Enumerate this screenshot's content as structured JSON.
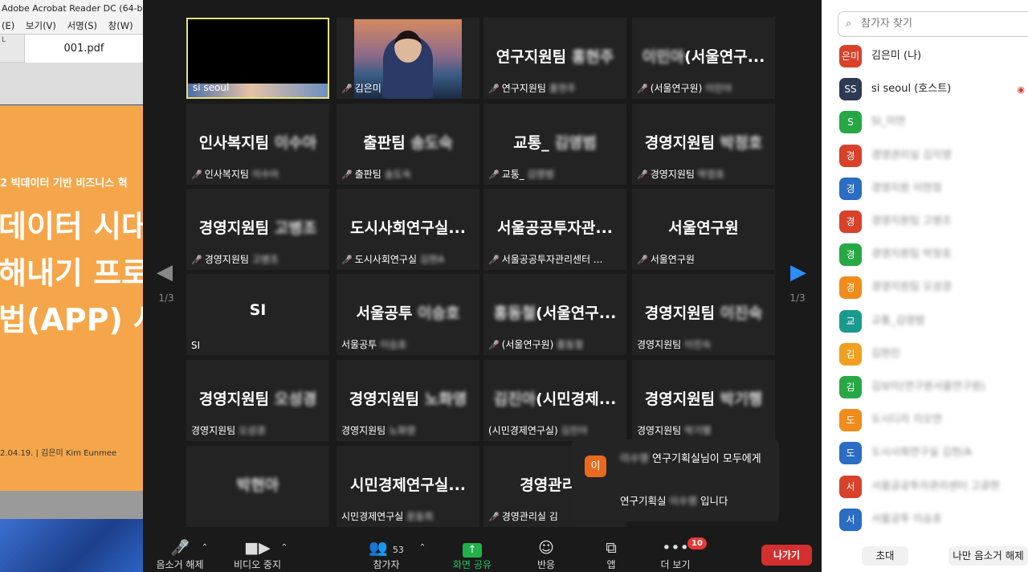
{
  "acrobat": {
    "title": "Adobe Acrobat Reader DC (64-b",
    "menus": [
      "(E)",
      "보기(V)",
      "서명(S)",
      "창(W)"
    ],
    "tab": "001.pdf",
    "tab_mark": "L",
    "slide_subtitle": "2 빅데이터 기반 비즈니스 혁",
    "slide_lines": [
      "데이터 시대",
      "해내기 프로",
      "법(APP) 사"
    ],
    "slide_footer": "2.04.19.   |   김은미 Kim Eunmee"
  },
  "tiles": [
    {
      "center": "",
      "label": "si seoul",
      "muted": false
    },
    {
      "center": "",
      "label": "김은미",
      "muted": true
    },
    {
      "center": "연구지원팀",
      "center_blur": "홍현주",
      "label": "연구지원팀",
      "label_blur": "홍현주",
      "muted": true
    },
    {
      "center": "(서울연구...",
      "center_blur": "이민아",
      "label": "(서울연구원)",
      "label_blur": "이민아",
      "muted": true
    },
    {
      "center": "인사복지팀",
      "center_blur": "이수아",
      "label": "인사복지팀",
      "label_blur": "이수아",
      "muted": true
    },
    {
      "center": "출판팀",
      "center_blur": "송도숙",
      "label": "출판팀",
      "label_blur": "송도숙",
      "muted": true
    },
    {
      "center": "교통_",
      "center_blur": "김영범",
      "label": "교통_",
      "label_blur": "김영범",
      "muted": true
    },
    {
      "center": "경영지원팀",
      "center_blur": "박정호",
      "label": "경영지원팀",
      "label_blur": "박정호",
      "muted": true
    },
    {
      "center": "경영지원팀",
      "center_blur": "고병조",
      "label": "경영지원팀",
      "label_blur": "고병조",
      "muted": true
    },
    {
      "center": "도시사회연구실...",
      "center_blur": "",
      "label": "도시사회연구실",
      "label_blur": "김현A",
      "muted": true
    },
    {
      "center": "서울공공투자관...",
      "center_blur": "",
      "label": "서울공공투자관리센터 ...",
      "label_blur": "",
      "muted": true
    },
    {
      "center": "서울연구원",
      "center_blur": "",
      "label": "서울연구원",
      "label_blur": "",
      "muted": true
    },
    {
      "center": "SI",
      "center_blur": "",
      "label": "SI",
      "label_blur": "",
      "muted": false
    },
    {
      "center": "서울공투",
      "center_blur": "이승호",
      "label": "서울공투",
      "label_blur": "이승호",
      "muted": false
    },
    {
      "center": "(서울연구...",
      "center_blur": "홍동철",
      "label": "(서울연구원)",
      "label_blur": "홍동철",
      "muted": true
    },
    {
      "center": "경영지원팀",
      "center_blur": "이진숙",
      "label": "경영지원팀",
      "label_blur": "이진숙",
      "muted": false
    },
    {
      "center": "경영지원팀",
      "center_blur": "오성경",
      "label": "경영지원팀",
      "label_blur": "오성경",
      "muted": false
    },
    {
      "center": "경영지원팀",
      "center_blur": "노화영",
      "label": "경영지원팀",
      "label_blur": "노화영",
      "muted": false
    },
    {
      "center": "(시민경제...",
      "center_blur": "김진아",
      "label": "(시민경제연구실)",
      "label_blur": "김진아",
      "muted": false
    },
    {
      "center": "경영지원팀",
      "center_blur": "박기행",
      "label": "경영지원팀",
      "label_blur": "박기행",
      "muted": false
    },
    {
      "center": "",
      "center_blur": "박현아",
      "label": "",
      "label_blur": "",
      "muted": false
    },
    {
      "center": "시민경제연구실...",
      "center_blur": "",
      "label": "시민경제연구실",
      "label_blur": "윤동희",
      "muted": false
    },
    {
      "center": "경영관리실",
      "center_blur": "",
      "label": "경영관리실 김",
      "label_blur": "",
      "muted": true
    }
  ],
  "paging": {
    "left": "1/3",
    "right": "1/3"
  },
  "toolbar": {
    "unmute": "음소거 해제",
    "video": "비디오 중지",
    "participants": "참가자",
    "participants_count": "53",
    "share": "화면 공유",
    "reactions": "반응",
    "apps": "앱",
    "more": "더 보기",
    "more_badge": "10",
    "leave": "나가기"
  },
  "notification": {
    "avatar": "이",
    "sender_blur": "이수영",
    "line1": "연구기획실님이 모두에게",
    "line2_a": "연구기획실",
    "line2_blur": "이수영",
    "line2_b": "입니다"
  },
  "panel": {
    "search_placeholder": "참가자 찾기",
    "participants": [
      {
        "avatar": "은미",
        "name": "김은미 (나)",
        "color": "#d9412b",
        "blur": false
      },
      {
        "avatar": "SS",
        "name": "si seoul (호스트)",
        "color": "#2e3a52",
        "blur": false,
        "rec": true
      },
      {
        "avatar": "S",
        "name": "SI_미연",
        "color": "#27a844",
        "blur": true
      },
      {
        "avatar": "경",
        "name": "경영관리실 김지영",
        "color": "#d9412b",
        "blur": true
      },
      {
        "avatar": "경",
        "name": "경영지원 이현정",
        "color": "#2b6cc4",
        "blur": true
      },
      {
        "avatar": "경",
        "name": "경영지원팀 고병조",
        "color": "#d9412b",
        "blur": true
      },
      {
        "avatar": "경",
        "name": "경영지원팀 박정호",
        "color": "#27a844",
        "blur": true
      },
      {
        "avatar": "경",
        "name": "경영지원팀 오성경",
        "color": "#f08c1c",
        "blur": true
      },
      {
        "avatar": "교",
        "name": "교통_김영범",
        "color": "#1a9a8c",
        "blur": true
      },
      {
        "avatar": "김",
        "name": "김현진",
        "color": "#f0a020",
        "blur": true
      },
      {
        "avatar": "김",
        "name": "김보미(연구원서울연구원)",
        "color": "#27a844",
        "blur": true
      },
      {
        "avatar": "도",
        "name": "도시디자 지오연",
        "color": "#f08c1c",
        "blur": true
      },
      {
        "avatar": "도",
        "name": "도시사회연구실 김현/A",
        "color": "#2b6cc4",
        "blur": true
      },
      {
        "avatar": "서",
        "name": "서울공공투자관리센터 고광현",
        "color": "#d9412b",
        "blur": true
      },
      {
        "avatar": "서",
        "name": "서울공투 이승호",
        "color": "#2b6cc4",
        "blur": true
      }
    ],
    "invite": "초대",
    "mute_me": "나만 음소거 해제"
  }
}
